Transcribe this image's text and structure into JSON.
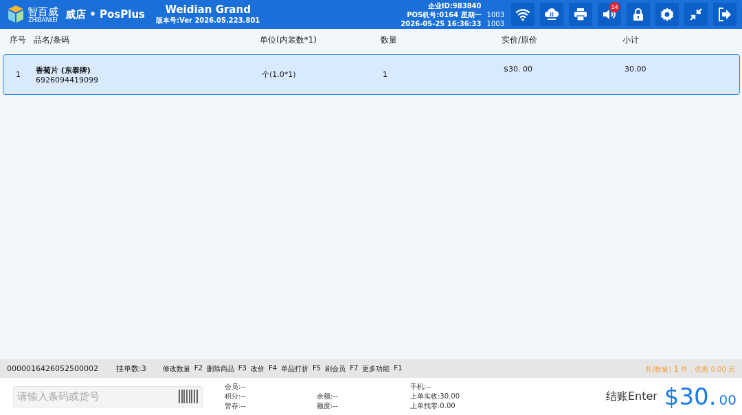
{
  "header": {
    "logo": {
      "name": "智百威",
      "subtitle": "ZHIBAIWEI"
    },
    "app_name": "威店 • PosPlus",
    "store": "Weidian Grand",
    "version": "版本号:Ver 2026.05.223.801",
    "company": "企业ID:983840",
    "pos": "POS机号:0164 星期一",
    "pos_code": "1003",
    "datetime": "2026-05-25 16:36:33",
    "datetime_code": "1003",
    "toolbar": [
      {
        "kind": "wifi"
      },
      {
        "kind": "cloud"
      },
      {
        "kind": "printer"
      },
      {
        "kind": "speaker",
        "badge": "14"
      },
      {
        "kind": "lock"
      },
      {
        "kind": "settings"
      },
      {
        "kind": "collapse"
      },
      {
        "kind": "exit"
      }
    ]
  },
  "table": {
    "columns": [
      "序号",
      "品名/条码",
      "单位(内装数*1)",
      "数量",
      "实价/原价",
      "小计"
    ],
    "rows": [
      {
        "no": "1",
        "name": "香菊片 (东泰牌)",
        "barcode": "6926094419099",
        "unit": "个(1.0*1)",
        "qty": "1",
        "price": "$30. 00",
        "subtotal": "30.00",
        "selected": true
      }
    ]
  },
  "status_bar": {
    "order_no": "0000016426052500002",
    "hold": "挂单数:3",
    "shortcuts": [
      {
        "label": "修改数量",
        "key": "F2"
      },
      {
        "label": "删除商品",
        "key": "F3"
      },
      {
        "label": "改价",
        "key": "F4"
      },
      {
        "label": "单品打折",
        "key": "F5"
      },
      {
        "label": "刷会员",
        "key": "F7"
      },
      {
        "label": "更多功能",
        "key": "F1"
      }
    ],
    "summary_prefix": "共(数量)",
    "count": "1",
    "summary_suffix": "件，优惠 0.00 元"
  },
  "footer": {
    "search": {
      "placeholder": "请输入条码或货号"
    },
    "info_columns": [
      [
        "会员:--",
        "积分:--",
        "暂存:--"
      ],
      [
        "余额:--",
        "额度:--"
      ],
      [
        "手机:--",
        "上单实收:30.00",
        "上单找零:0.00"
      ]
    ],
    "checkout": "结账Enter",
    "total": "$30.",
    "cents": "00"
  }
}
